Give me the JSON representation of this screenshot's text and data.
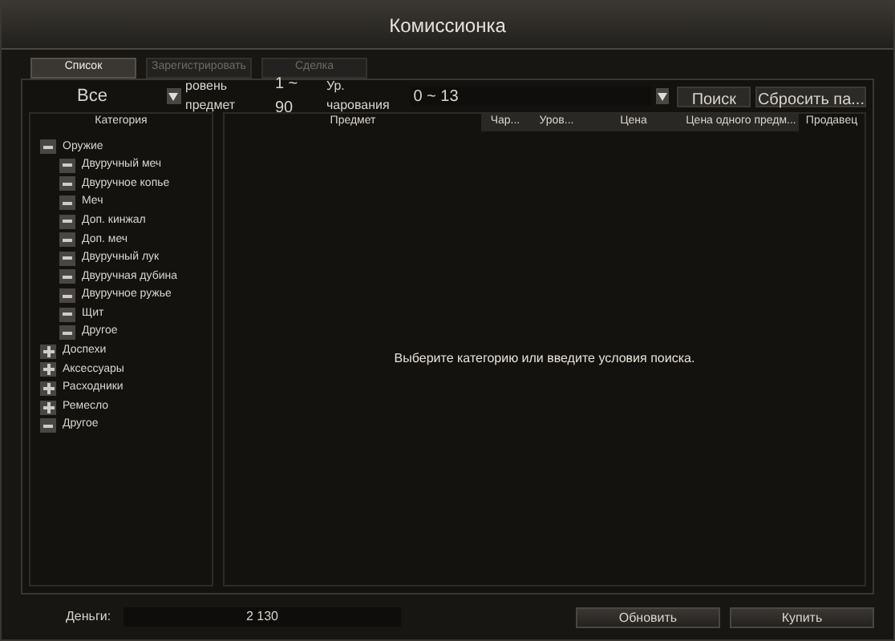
{
  "window": {
    "title": "Комиссионка"
  },
  "tabs": [
    {
      "label": "Список",
      "selected": true
    },
    {
      "label": "Зарегистрировать",
      "selected": false
    },
    {
      "label": "Сделка",
      "selected": false
    }
  ],
  "filters": {
    "grade": "Все",
    "level_label": "ровень предмет",
    "level_range": "1 ~ 90",
    "enchant_label": "Ур. чарования",
    "enchant_range": "0 ~ 13",
    "search_button": "Поиск",
    "reset_button": "Сбросить па..."
  },
  "category_header": "Категория",
  "categories": [
    {
      "label": "Оружие",
      "expanded": true,
      "children": [
        {
          "label": "Двуручный меч",
          "expanded": true
        },
        {
          "label": "Двуручное копье",
          "expanded": true
        },
        {
          "label": "Меч",
          "expanded": true
        },
        {
          "label": "Доп. кинжал",
          "expanded": true
        },
        {
          "label": "Доп. меч",
          "expanded": true
        },
        {
          "label": "Двуручный лук",
          "expanded": true
        },
        {
          "label": "Двуручная дубина",
          "expanded": true
        },
        {
          "label": "Двуручное ружье",
          "expanded": true
        },
        {
          "label": "Щит",
          "expanded": true
        },
        {
          "label": "Другое",
          "expanded": true
        }
      ]
    },
    {
      "label": "Доспехи",
      "expanded": false
    },
    {
      "label": "Аксессуары",
      "expanded": false
    },
    {
      "label": "Расходники",
      "expanded": false
    },
    {
      "label": "Ремесло",
      "expanded": false
    },
    {
      "label": "Другое",
      "expanded": true
    }
  ],
  "table": {
    "columns": [
      {
        "label": "Предмет",
        "selected": false
      },
      {
        "label": "Чар...",
        "selected": true
      },
      {
        "label": "Уров...",
        "selected": true
      },
      {
        "label": "Цена",
        "selected": true
      },
      {
        "label": "Цена одного предм...",
        "selected": true
      },
      {
        "label": "Продавец",
        "selected": false
      }
    ],
    "empty_message": "Выберите категорию или введите условия поиска."
  },
  "money": {
    "label": "Деньги:",
    "value": "2 130"
  },
  "buttons": [
    "Обновить",
    "Купить"
  ]
}
